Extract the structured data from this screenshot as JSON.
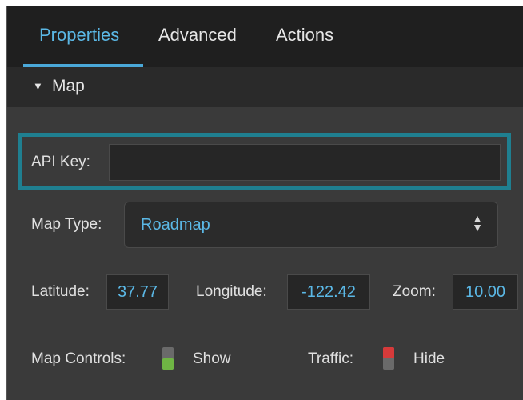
{
  "tabs": [
    {
      "label": "Properties",
      "active": true
    },
    {
      "label": "Advanced",
      "active": false
    },
    {
      "label": "Actions",
      "active": false
    }
  ],
  "section": {
    "title": "Map",
    "arrow": "▼",
    "expanded": true
  },
  "api_key": {
    "label": "API Key:",
    "value": ""
  },
  "map_type": {
    "label": "Map Type:",
    "value": "Roadmap",
    "arrows_icon": "up-down-arrows-icon"
  },
  "latitude": {
    "label": "Latitude:",
    "value": "37.77"
  },
  "longitude": {
    "label": "Longitude:",
    "value": "-122.42"
  },
  "zoom": {
    "label": "Zoom:",
    "value": "10.00"
  },
  "map_controls": {
    "label": "Map Controls:",
    "state": "Show",
    "indicator_color": "#6fb544"
  },
  "traffic": {
    "label": "Traffic:",
    "state": "Hide",
    "indicator_color": "#d63a3a"
  },
  "colors": {
    "accent": "#5bb8e6",
    "highlight_border": "#1f7f90",
    "panel_bg": "#3a3a3a",
    "tabbar_bg": "#1f1f1f"
  }
}
